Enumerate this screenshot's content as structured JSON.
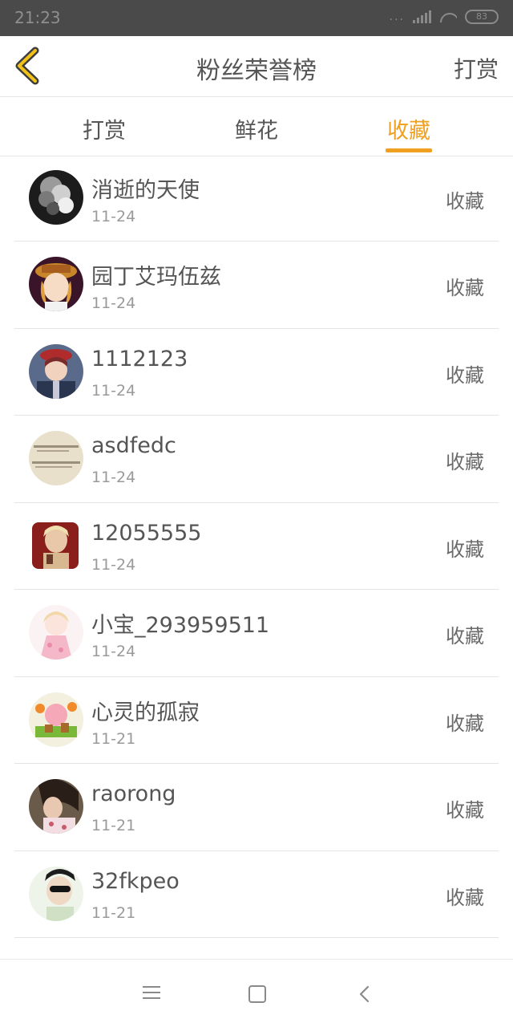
{
  "status_bar": {
    "time": "21:23",
    "battery": "83",
    "signal_dots": "..."
  },
  "header": {
    "title": "粉丝荣誉榜",
    "action": "打赏"
  },
  "tabs": [
    {
      "label": "打赏"
    },
    {
      "label": "鲜花"
    },
    {
      "label": "收藏"
    }
  ],
  "active_tab": "收藏",
  "accent_color": "#f0a020",
  "list": {
    "items": [
      {
        "name": "",
        "date": "11-24",
        "action": "收藏",
        "avatar": "dark-girl"
      },
      {
        "name": "消逝的天使",
        "date": "11-24",
        "action": "收藏",
        "avatar": "smoke-bw"
      },
      {
        "name": "园丁艾玛伍兹",
        "date": "11-24",
        "action": "收藏",
        "avatar": "anime-girl-hat"
      },
      {
        "name": "1112123",
        "date": "11-24",
        "action": "收藏",
        "avatar": "anime-boy-cap"
      },
      {
        "name": "asdfedc",
        "date": "11-24",
        "action": "收藏",
        "avatar": "handwriting-note"
      },
      {
        "name": "12055555",
        "date": "11-24",
        "action": "收藏",
        "avatar": "red-portrait"
      },
      {
        "name": "小宝_293959511",
        "date": "11-24",
        "action": "收藏",
        "avatar": "pink-anime-girl"
      },
      {
        "name": "心灵的孤寂",
        "date": "11-21",
        "action": "收藏",
        "avatar": "cartoon-pig"
      },
      {
        "name": "raorong",
        "date": "11-21",
        "action": "收藏",
        "avatar": "girl-photo"
      },
      {
        "name": "32fkpeo",
        "date": "11-21",
        "action": "收藏",
        "avatar": "man-sunglasses"
      }
    ]
  },
  "icons": {
    "back": "chevron-left-icon",
    "nav_menu": "menu-icon",
    "nav_home": "home-square-icon",
    "nav_back": "back-arrow-icon"
  }
}
